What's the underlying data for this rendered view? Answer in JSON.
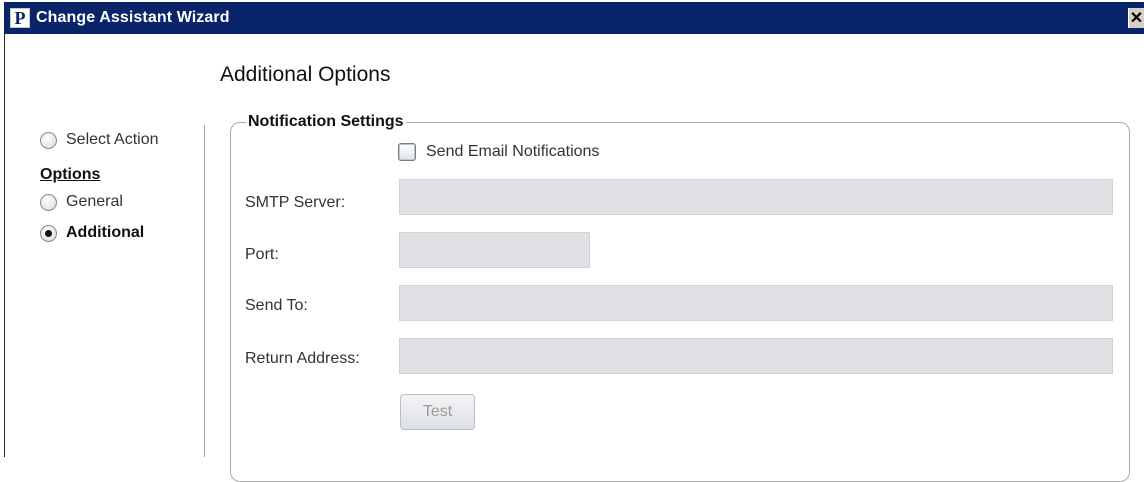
{
  "window": {
    "title": "Change Assistant Wizard",
    "logo_letter": "P",
    "close_glyph": "✕"
  },
  "page": {
    "title": "Additional Options"
  },
  "nav": {
    "select_action": "Select Action",
    "options_heading": "Options",
    "general": "General",
    "additional": "Additional",
    "selected": "Additional"
  },
  "notification": {
    "legend": "Notification Settings",
    "send_email_label": "Send Email Notifications",
    "send_email_checked": false,
    "smtp_label": "SMTP Server:",
    "smtp_value": "",
    "port_label": "Port:",
    "port_value": "",
    "send_to_label": "Send To:",
    "send_to_value": "",
    "return_address_label": "Return Address:",
    "return_address_value": "",
    "test_button": "Test"
  },
  "colors": {
    "titlebar": "#0a246a",
    "disabled_field": "#dfe1e5",
    "disabled_text": "#9a9a9a"
  }
}
